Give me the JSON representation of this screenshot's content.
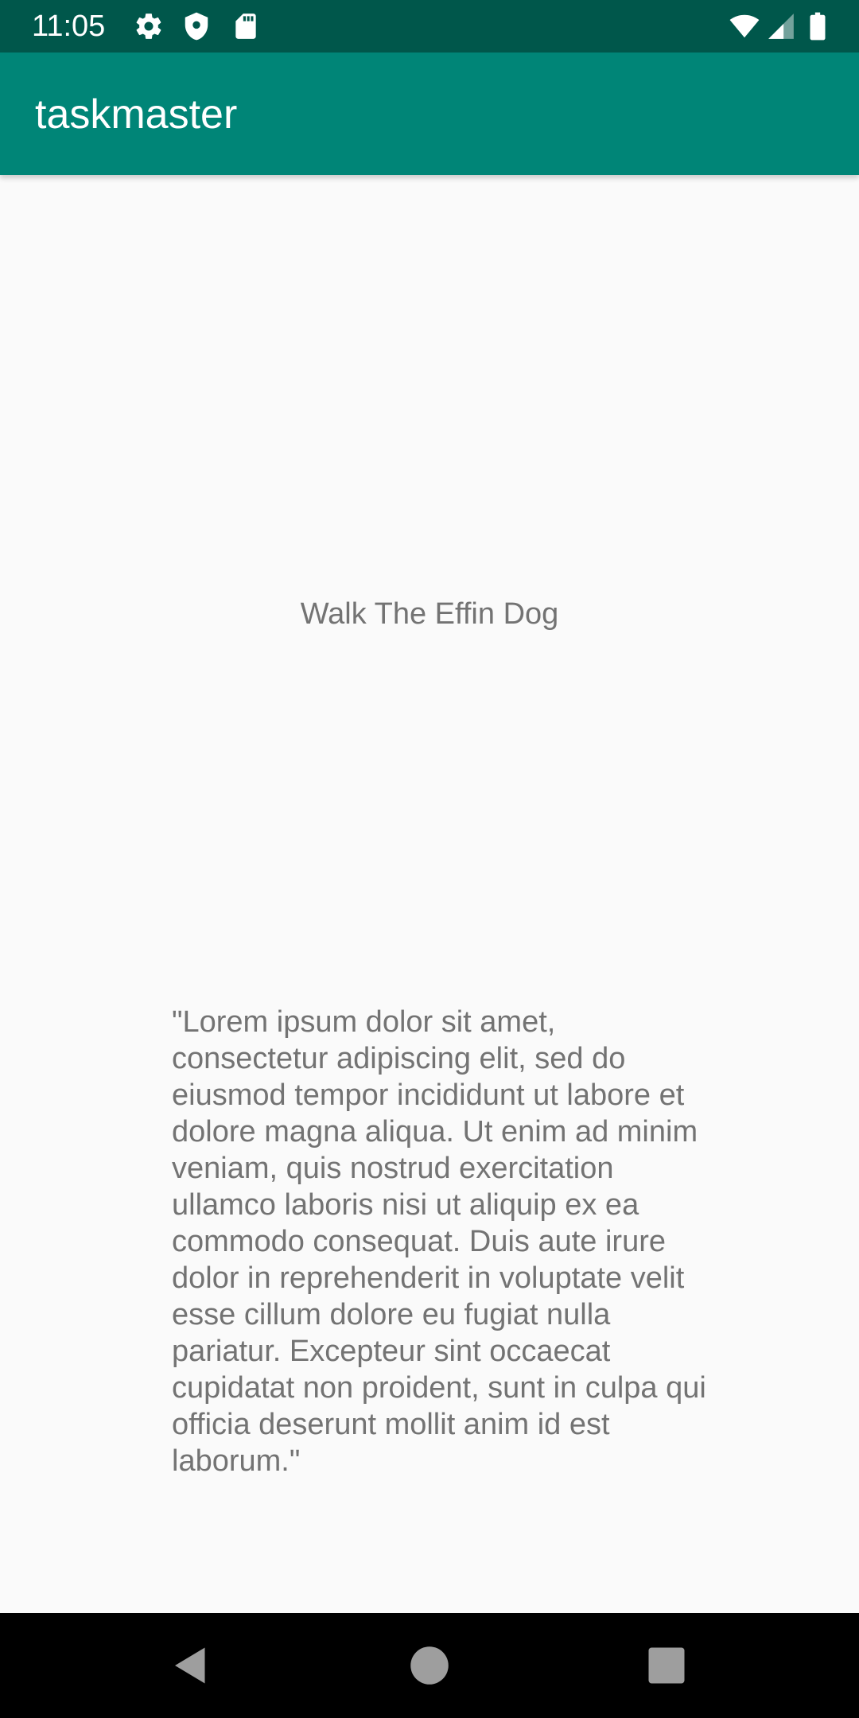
{
  "status_bar": {
    "time": "11:05",
    "left_icons": [
      "settings-gear-icon",
      "shield-icon",
      "sd-card-icon"
    ],
    "right_icons": [
      "wifi-icon",
      "cell-signal-icon",
      "battery-icon"
    ]
  },
  "app_bar": {
    "title": "taskmaster"
  },
  "task": {
    "title": "Walk The Effin Dog",
    "body": "\"Lorem ipsum dolor sit amet, consectetur adipiscing elit, sed do eiusmod tempor incididunt ut labore et dolore magna aliqua. Ut enim ad minim veniam, quis nostrud exercitation ullamco laboris nisi ut aliquip ex ea commodo consequat. Duis aute irure dolor in reprehenderit in voluptate velit esse cillum dolore eu fugiat nulla pariatur. Excepteur sint occaecat cupidatat non proident, sunt in culpa qui officia deserunt mollit anim id est laborum.\""
  },
  "nav_bar": {
    "buttons": [
      "back-icon",
      "home-icon",
      "recents-icon"
    ]
  },
  "colors": {
    "status_bar": "#00574b",
    "app_bar": "#008577",
    "background": "#fafafa",
    "text_secondary": "#737373",
    "nav_bar": "#000000"
  }
}
